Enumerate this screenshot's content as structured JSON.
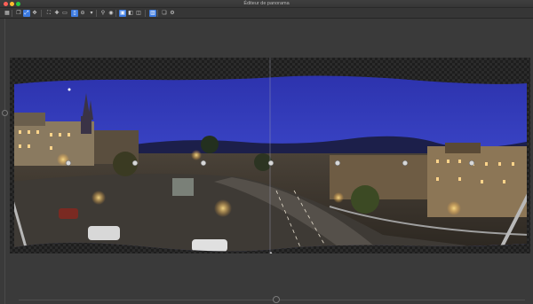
{
  "window": {
    "title": "Éditeur de panorama"
  },
  "toolbar": {
    "buttons": [
      {
        "icon": "grid-icon",
        "glyph": "▦",
        "active": false
      },
      {
        "icon": "duplicate-icon",
        "glyph": "❐",
        "active": false
      },
      {
        "icon": "straighten-icon",
        "glyph": "⤢",
        "active": true
      },
      {
        "icon": "move-icon",
        "glyph": "✥",
        "active": false
      },
      {
        "icon": "fit-icon",
        "glyph": "⛶",
        "active": false
      },
      {
        "icon": "crosshair-icon",
        "glyph": "✚",
        "active": false
      },
      {
        "icon": "frame-icon",
        "glyph": "▭",
        "active": false
      },
      {
        "icon": "crop-icon",
        "glyph": "▯",
        "active": true
      },
      {
        "icon": "rotate-icon",
        "glyph": "⊖",
        "active": false
      },
      {
        "icon": "dropdown-icon",
        "glyph": "▾",
        "active": false
      },
      {
        "icon": "zoom-icon",
        "glyph": "⚲",
        "active": false
      },
      {
        "icon": "eye-icon",
        "glyph": "◉",
        "active": false
      },
      {
        "icon": "view-single-icon",
        "glyph": "▣",
        "active": true
      },
      {
        "icon": "view-split-icon",
        "glyph": "◧",
        "active": false
      },
      {
        "icon": "view-compare-icon",
        "glyph": "◫",
        "active": false
      },
      {
        "icon": "panorama-icon",
        "glyph": "▥",
        "active": true
      },
      {
        "icon": "layers-icon",
        "glyph": "❏",
        "active": false
      },
      {
        "icon": "settings-icon",
        "glyph": "⚙",
        "active": false
      }
    ]
  },
  "colors": {
    "accent": "#3d7be0",
    "background": "#3a3a3a",
    "toolbar": "#363636"
  }
}
